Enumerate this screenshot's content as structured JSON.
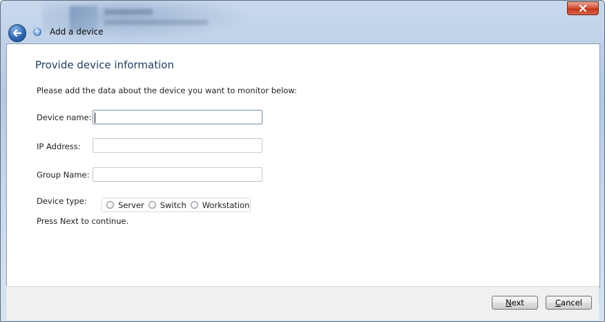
{
  "window": {
    "title": "Add a device"
  },
  "page": {
    "heading": "Provide device information",
    "instruction": "Please add the data about the device you want to monitor below:"
  },
  "form": {
    "device_name": {
      "label": "Device name:",
      "value": ""
    },
    "ip_address": {
      "label": "IP Address:",
      "value": ""
    },
    "group_name": {
      "label": "Group Name:",
      "value": ""
    },
    "device_type": {
      "label": "Device type:",
      "options": [
        "Server",
        "Switch",
        "Workstation"
      ],
      "selected": null
    }
  },
  "continue_text": "Press Next to continue.",
  "buttons": {
    "next": "Next",
    "cancel": "Cancel"
  },
  "icons": {
    "close": "close-icon",
    "back": "back-arrow-icon",
    "app": "globe-icon"
  }
}
